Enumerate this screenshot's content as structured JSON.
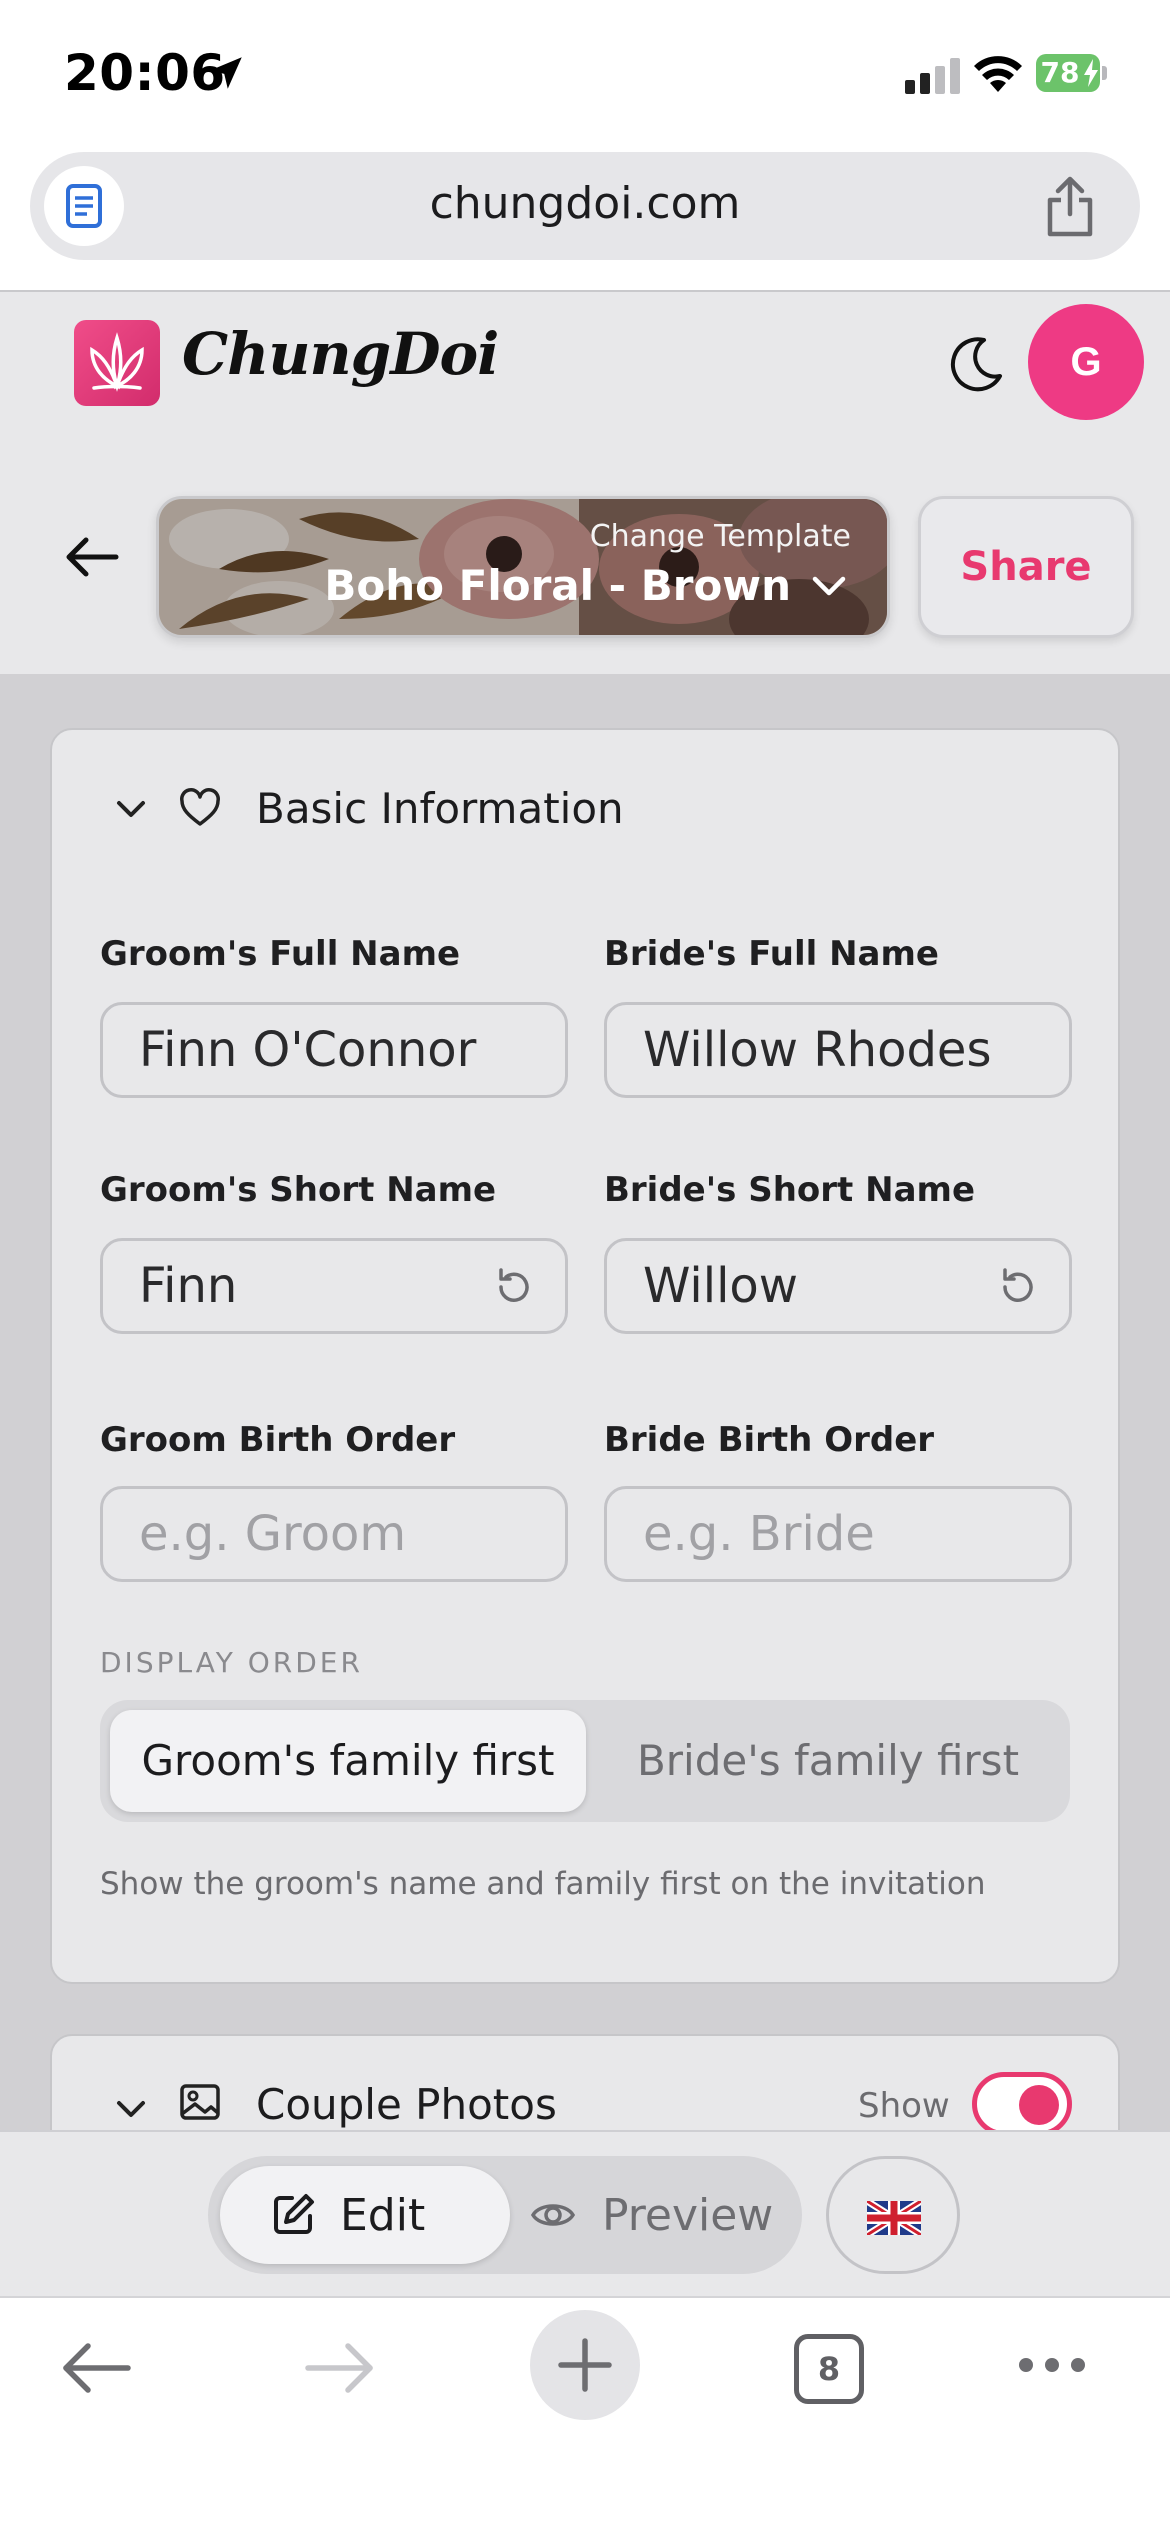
{
  "status_bar": {
    "time": "20:06",
    "battery_level": "78",
    "icons": [
      "location-arrow-icon",
      "cellular-signal-icon",
      "wifi-icon",
      "battery-charging-icon"
    ]
  },
  "browser": {
    "url": "chungdoi.com",
    "tab_count": "8"
  },
  "app": {
    "brand": "ChungDoi",
    "avatar_initial": "G",
    "brand_color": "#ee3a84",
    "template": {
      "caption": "Change Template",
      "name": "Boho Floral - Brown"
    },
    "share_label": "Share"
  },
  "basic_info": {
    "title": "Basic Information",
    "groom_full_name_label": "Groom's Full Name",
    "groom_full_name_value": "Finn O'Connor",
    "bride_full_name_label": "Bride's Full Name",
    "bride_full_name_value": "Willow Rhodes",
    "groom_short_name_label": "Groom's Short Name",
    "groom_short_name_value": "Finn",
    "bride_short_name_label": "Bride's Short Name",
    "bride_short_name_value": "Willow",
    "groom_birth_order_label": "Groom Birth Order",
    "groom_birth_order_placeholder": "e.g. Groom",
    "bride_birth_order_label": "Bride Birth Order",
    "bride_birth_order_placeholder": "e.g. Bride",
    "display_order_label": "DISPLAY ORDER",
    "display_order_options": [
      "Groom's family first",
      "Bride's family first"
    ],
    "display_order_selected": "Groom's family first",
    "display_order_help": "Show the groom's name and family first on the invitation"
  },
  "couple_photos": {
    "title": "Couple Photos",
    "show_label": "Show",
    "show_enabled": true
  },
  "mode_bar": {
    "edit_label": "Edit",
    "preview_label": "Preview",
    "active_mode": "Edit",
    "language_flag": "uk-flag-icon"
  },
  "colors": {
    "accent": "#e8396f",
    "battery_green": "#6cc36a"
  }
}
